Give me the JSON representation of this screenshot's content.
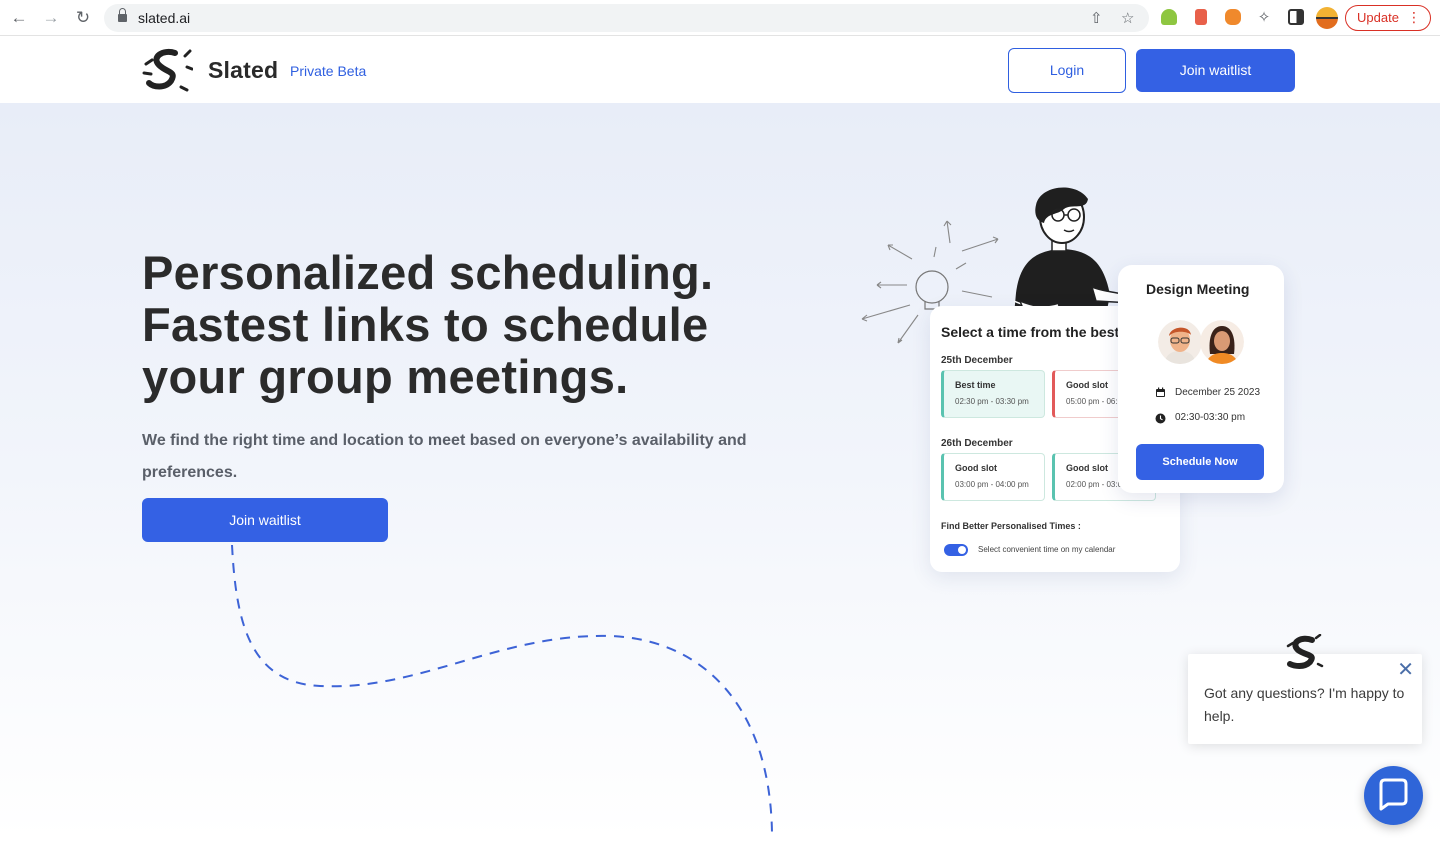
{
  "browser": {
    "url": "slated.ai",
    "update_label": "Update"
  },
  "header": {
    "brand": "Slated",
    "beta_label": "Private Beta",
    "login_label": "Login",
    "join_label": "Join waitlist"
  },
  "hero": {
    "headline_line1": "Personalized scheduling.",
    "headline_line2": "Fastest links to schedule",
    "headline_line3": "your group meetings.",
    "subtext": "We find the right time and location to meet based on everyone’s availability and preferences.",
    "join_label": "Join waitlist"
  },
  "schedule_card": {
    "title": "Select a time from the best",
    "day1": "25th December",
    "day2": "26th December",
    "slots": [
      {
        "name": "Best time",
        "time": "02:30 pm - 03:30 pm"
      },
      {
        "name": "Good slot",
        "time": "05:00 pm - 06:00 pm"
      },
      {
        "name": "Good slot",
        "time": "03:00 pm - 04:00 pm"
      },
      {
        "name": "Good slot",
        "time": "02:00 pm - 03:00 pm"
      }
    ],
    "find_label": "Find Better Personalised Times :",
    "toggle_label": "Select convenient time on my calendar"
  },
  "meeting_card": {
    "title": "Design Meeting",
    "date": "December 25 2023",
    "time": "02:30-03:30 pm",
    "button_label": "Schedule Now"
  },
  "chat": {
    "message": "Got any questions? I'm happy to help.",
    "close_icon": "close-icon"
  },
  "colors": {
    "accent": "#3461e4",
    "teal": "#5ac3b0",
    "red": "#e25a5a"
  }
}
